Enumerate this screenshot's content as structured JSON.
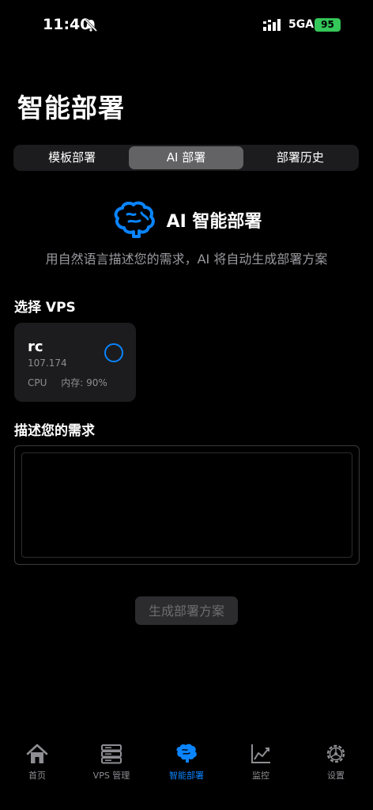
{
  "status_bar": {
    "time": "11:40",
    "network": "5GA",
    "battery": "95"
  },
  "page": {
    "title": "智能部署"
  },
  "segments": [
    {
      "label": "模板部署",
      "active": false
    },
    {
      "label": "AI 部署",
      "active": true
    },
    {
      "label": "部署历史",
      "active": false
    }
  ],
  "ai_section": {
    "title": "AI 智能部署",
    "subtitle": "用自然语言描述您的需求，AI 将自动生成部署方案",
    "icon": "brain-icon"
  },
  "vps_section": {
    "label": "选择 VPS",
    "card": {
      "name": "rc",
      "ip": "107.174",
      "cpu_label": "CPU",
      "mem_label": "内存: 90%"
    }
  },
  "requirement": {
    "label": "描述您的需求",
    "value": "",
    "placeholder": ""
  },
  "generate_button": {
    "label": "生成部署方案"
  },
  "tab_bar": [
    {
      "label": "首页",
      "icon": "house-icon",
      "active": false
    },
    {
      "label": "VPS 管理",
      "icon": "server-icon",
      "active": false
    },
    {
      "label": "智能部署",
      "icon": "brain-icon",
      "active": true
    },
    {
      "label": "监控",
      "icon": "chart-icon",
      "active": false
    },
    {
      "label": "设置",
      "icon": "gear-icon",
      "active": false
    }
  ],
  "colors": {
    "accent": "#0a84ff",
    "battery": "#34c759",
    "card_bg": "#1c1c1e"
  }
}
